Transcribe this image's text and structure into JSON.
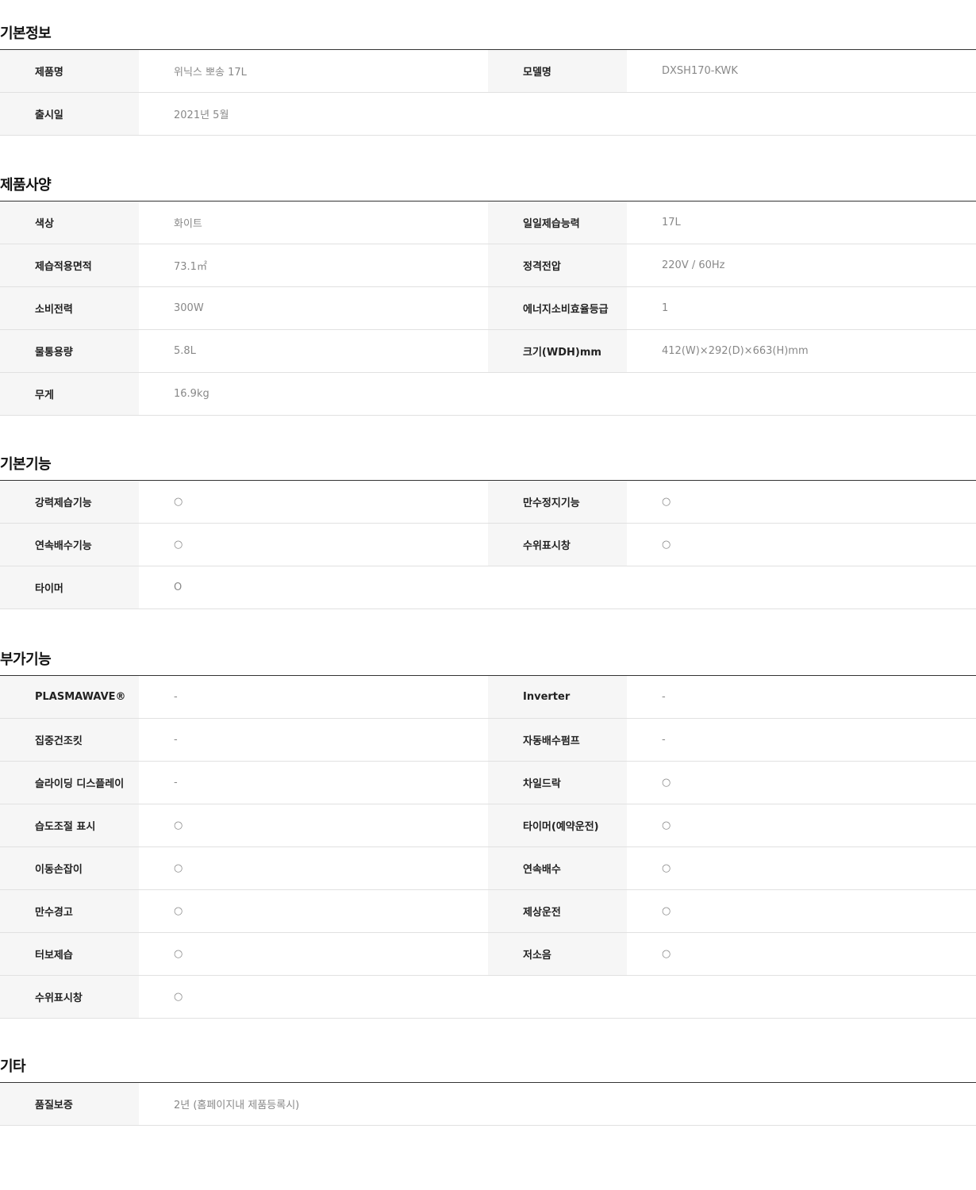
{
  "sections": [
    {
      "title": "기본정보",
      "rows": [
        [
          {
            "label": "제품명",
            "value": "위닉스 뽀송 17L"
          },
          {
            "label": "모델명",
            "value": "DXSH170-KWK"
          }
        ],
        [
          {
            "label": "출시일",
            "value": "2021년 5월"
          }
        ]
      ]
    },
    {
      "title": "제품사양",
      "rows": [
        [
          {
            "label": "색상",
            "value": "화이트"
          },
          {
            "label": "일일제습능력",
            "value": "17L"
          }
        ],
        [
          {
            "label": "제습적용면적",
            "value": "73.1㎡"
          },
          {
            "label": "정격전압",
            "value": "220V / 60Hz"
          }
        ],
        [
          {
            "label": "소비전력",
            "value": "300W"
          },
          {
            "label": "에너지소비효율등급",
            "value": "1"
          }
        ],
        [
          {
            "label": "물통용량",
            "value": "5.8L"
          },
          {
            "label": "크기(WDH)mm",
            "value": "412(W)×292(D)×663(H)mm"
          }
        ],
        [
          {
            "label": "무게",
            "value": "16.9kg"
          }
        ]
      ]
    },
    {
      "title": "기본기능",
      "rows": [
        [
          {
            "label": "강력제습기능",
            "value": "○"
          },
          {
            "label": "만수정지기능",
            "value": "○"
          }
        ],
        [
          {
            "label": "연속배수기능",
            "value": "○"
          },
          {
            "label": "수위표시창",
            "value": "○"
          }
        ],
        [
          {
            "label": "타이머",
            "value": "O"
          }
        ]
      ]
    },
    {
      "title": "부가기능",
      "rows": [
        [
          {
            "label": "PLASMAWAVE®",
            "value": "-"
          },
          {
            "label": "Inverter",
            "value": "-"
          }
        ],
        [
          {
            "label": "집중건조킷",
            "value": "-"
          },
          {
            "label": "자동배수펌프",
            "value": "-"
          }
        ],
        [
          {
            "label": "슬라이딩 디스플레이",
            "value": "-"
          },
          {
            "label": "차일드락",
            "value": "○"
          }
        ],
        [
          {
            "label": "습도조절 표시",
            "value": "○"
          },
          {
            "label": "타이머(예약운전)",
            "value": "○"
          }
        ],
        [
          {
            "label": "이동손잡이",
            "value": "○"
          },
          {
            "label": "연속배수",
            "value": "○"
          }
        ],
        [
          {
            "label": "만수경고",
            "value": "○"
          },
          {
            "label": "제상운전",
            "value": "○"
          }
        ],
        [
          {
            "label": "터보제습",
            "value": "○"
          },
          {
            "label": "저소음",
            "value": "○"
          }
        ],
        [
          {
            "label": "수위표시창",
            "value": "○"
          }
        ]
      ]
    },
    {
      "title": "기타",
      "rows": [
        [
          {
            "label": "품질보증",
            "value": "2년 (홈페이지내 제품등록시)"
          }
        ]
      ]
    }
  ]
}
